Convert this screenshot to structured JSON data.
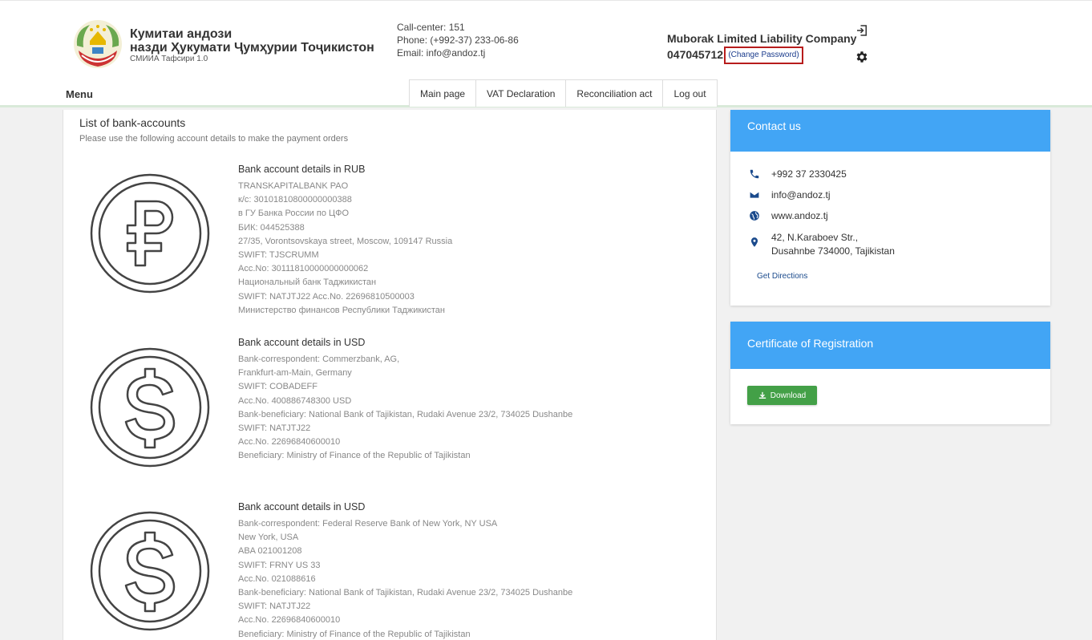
{
  "header": {
    "org_line1": "Кумитаи андози",
    "org_line2": "назди Ҳукумати Ҷумҳурии Тоҷикистон",
    "org_line3": "СМИИА Тафсири 1.0",
    "callcenter": "Call-center: 151",
    "phone": "Phone: (+992-37) 233-06-86",
    "email": "Email: info@andoz.tj",
    "company_name": "Muborak Limited Liability Company",
    "tin": "047045712",
    "change_password": "(Change Password)"
  },
  "nav": {
    "menu_label": "Menu",
    "tabs": [
      "Main page",
      "VAT Declaration",
      "Reconciliation act",
      "Log out"
    ]
  },
  "main": {
    "title": "List of bank-accounts",
    "subtitle": "Please use the following account details to make the payment orders",
    "accounts": [
      {
        "heading": "Bank account details in RUB",
        "lines": [
          "TRANSKAPITALBANK PAO",
          "к/с: 30101810800000000388",
          "в ГУ Банка России по ЦФО",
          "БИК: 044525388",
          "27/35, Vorontsovskaya street, Moscow, 109147 Russia",
          "SWIFT: TJSCRUMM",
          "Acc.No: 30111810000000000062",
          "Национальный банк Таджикистан",
          "SWIFT: NATJTJ22 Acc.No. 22696810500003",
          "Министерство финансов Республики Таджикистан"
        ]
      },
      {
        "heading": "Bank account details in USD",
        "lines": [
          "Bank-correspondent: Commerzbank, AG,",
          "Frankfurt-am-Main, Germany",
          "SWIFT: COBADEFF",
          "Acc.No. 400886748300 USD",
          "Bank-beneficiary: National Bank of Tajikistan, Rudaki Avenue 23/2, 734025 Dushanbe",
          "SWIFT: NATJTJ22",
          "Acc.No. 22696840600010",
          "Beneficiary: Ministry of Finance of the Republic of Tajikistan"
        ]
      },
      {
        "heading": "Bank account details in USD",
        "lines": [
          "Bank-correspondent: Federal Reserve Bank of New York, NY USA",
          "New York, USA",
          "ABA 021001208",
          "SWIFT: FRNY US 33",
          "Acc.No. 021088616",
          "Bank-beneficiary: National Bank of Tajikistan, Rudaki Avenue 23/2, 734025 Dushanbe",
          "SWIFT: NATJTJ22",
          "Acc.No. 22696840600010",
          "Beneficiary: Ministry of Finance of the Republic of Tajikistan"
        ]
      }
    ]
  },
  "contact": {
    "title": "Contact us",
    "phone": "+992 37 2330425",
    "email": "info@andoz.tj",
    "web": "www.andoz.tj",
    "address1": "42, N.Karaboev Str.,",
    "address2": "Dusahnbe 734000, Tajikistan",
    "directions": "Get Directions"
  },
  "certificate": {
    "title": "Certificate of Registration",
    "download": "Download"
  },
  "colors": {
    "accent_blue": "#42a5f5",
    "download_green": "#43a047",
    "change_password_border": "#b71c1c"
  }
}
